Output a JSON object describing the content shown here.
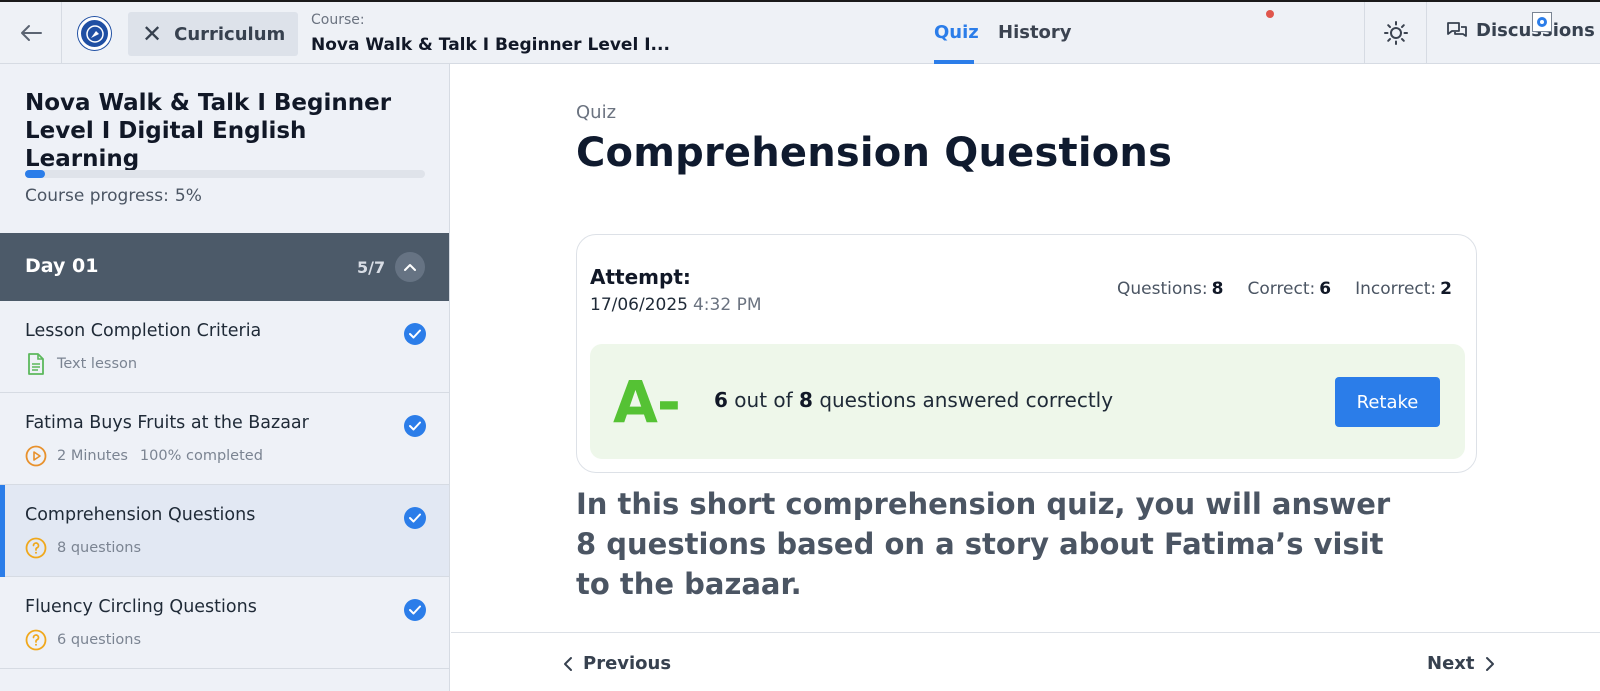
{
  "topbar": {
    "curriculum_label": "Curriculum",
    "course_label": "Course:",
    "course_name": "Nova Walk & Talk I Beginner Level I...",
    "tabs": [
      {
        "label": "Quiz",
        "active": true
      },
      {
        "label": "History",
        "active": false
      }
    ],
    "discussions_label": "Discussions",
    "icons": [
      "arrow-left-icon",
      "logo-icon",
      "close-icon",
      "sun-icon",
      "discussions-icon"
    ]
  },
  "sidebar": {
    "course_title": "Nova Walk & Talk I Beginner Level I Digital English Learning",
    "progress_label": "Course progress:",
    "progress_value": "5%",
    "progress_fraction": 0.05,
    "section": {
      "title": "Day 01",
      "count": "5/7"
    },
    "lessons": [
      {
        "name": "Lesson Completion Criteria",
        "meta": "Text lesson",
        "meta2": "",
        "icon": "document-icon",
        "completed": true,
        "active": false
      },
      {
        "name": "Fatima Buys Fruits at the Bazaar",
        "meta": "2 Minutes",
        "meta2": "100% completed",
        "icon": "play-icon",
        "completed": true,
        "active": false
      },
      {
        "name": "Comprehension Questions",
        "meta": "8 questions",
        "meta2": "",
        "icon": "question-icon",
        "completed": true,
        "active": true
      },
      {
        "name": "Fluency Circling Questions",
        "meta": "6 questions",
        "meta2": "",
        "icon": "question-icon",
        "completed": true,
        "active": false
      }
    ]
  },
  "main": {
    "label": "Quiz",
    "title": "Comprehension Questions",
    "attempt": {
      "label": "Attempt:",
      "date": "17/06/2025",
      "time": "4:32 PM",
      "questions_label": "Questions:",
      "questions_value": "8",
      "correct_label": "Correct:",
      "correct_value": "6",
      "incorrect_label": "Incorrect:",
      "incorrect_value": "2"
    },
    "result": {
      "grade": "A-",
      "correct": "6",
      "out_of_text": "out of",
      "total": "8",
      "suffix_text": "questions answered correctly",
      "retake_label": "Retake"
    },
    "intro": "In this short comprehension quiz, you will answer 8 questions based on a story about Fatima’s visit to the bazaar."
  },
  "footer": {
    "previous_label": "Previous",
    "next_label": "Next"
  },
  "colors": {
    "accent": "#2b7de9",
    "grade_green": "#55c234",
    "section_header": "#4c5a69",
    "result_bg": "#eef7ea"
  }
}
